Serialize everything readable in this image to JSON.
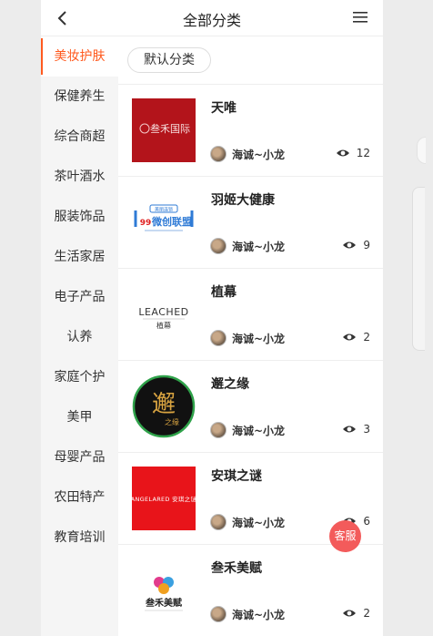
{
  "header": {
    "title": "全部分类"
  },
  "sidebar": {
    "items": [
      {
        "label": "美妆护肤",
        "active": true
      },
      {
        "label": "保健养生"
      },
      {
        "label": "综合商超"
      },
      {
        "label": "茶叶酒水"
      },
      {
        "label": "服装饰品"
      },
      {
        "label": "生活家居"
      },
      {
        "label": "电子产品"
      },
      {
        "label": "认养"
      },
      {
        "label": "家庭个护"
      },
      {
        "label": "美甲"
      },
      {
        "label": "母婴产品"
      },
      {
        "label": "农田特产"
      },
      {
        "label": "教育培训"
      }
    ]
  },
  "filter": {
    "default_label": "默认分类"
  },
  "cards": [
    {
      "brand": "天唯",
      "author": "海诚~小龙",
      "views": "12",
      "logo": {
        "text": "叁禾国际",
        "bg": "#b3141b"
      }
    },
    {
      "brand": "羽姬大健康",
      "author": "海诚~小龙",
      "views": "9",
      "logo": {
        "text": "99 微创联盟",
        "bg": "#ffffff"
      }
    },
    {
      "brand": "植幕",
      "author": "海诚~小龙",
      "views": "2",
      "logo": {
        "text": "LEACHED",
        "sub": "植幕",
        "bg": "#ffffff"
      }
    },
    {
      "brand": "邂之缘",
      "author": "海诚~小龙",
      "views": "3",
      "logo": {
        "text": "邂",
        "sub": "之缘",
        "bg": "#111111"
      }
    },
    {
      "brand": "安琪之谜",
      "author": "海诚~小龙",
      "views": "6",
      "logo": {
        "text": "ANGELARED",
        "bg": "#e8141a"
      }
    },
    {
      "brand": "叁禾美赋",
      "author": "海诚~小龙",
      "views": "2",
      "logo": {
        "text": "叁禾美赋",
        "bg": "#ffffff"
      }
    }
  ],
  "float": {
    "service_label": "客服"
  },
  "colors": {
    "accent": "#ff5a1f",
    "service": "#f35b5b"
  }
}
